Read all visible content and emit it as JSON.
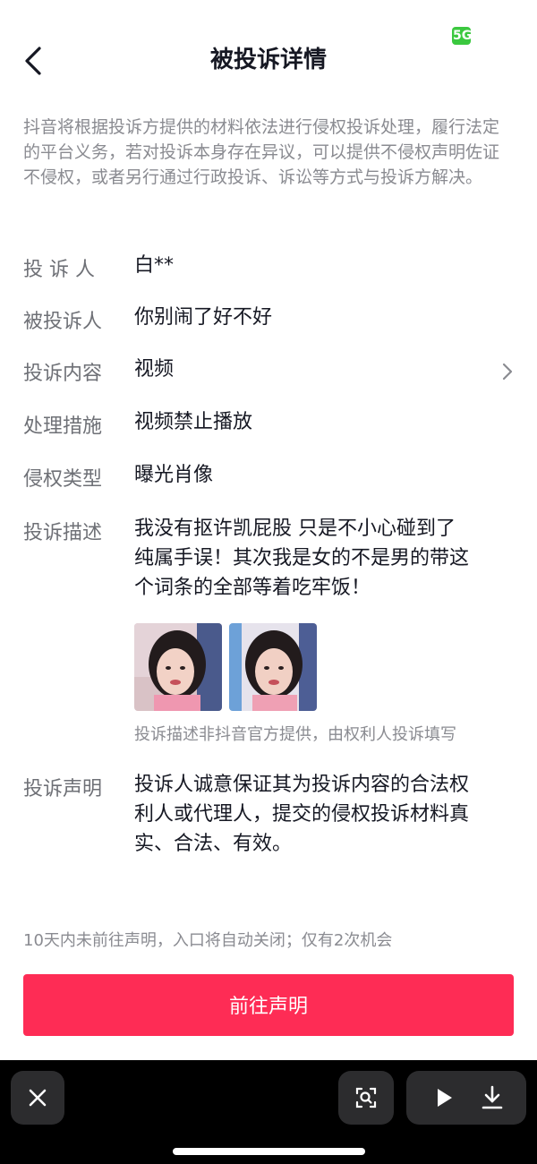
{
  "header": {
    "title": "被投诉详情",
    "signal_badge": "5G"
  },
  "intro": "抖音将根据投诉方提供的材料依法进行侵权投诉处理，履行法定的平台义务，若对投诉本身存在异议，可以提供不侵权声明佐证不侵权，或者另行通过行政投诉、诉讼等方式与投诉方解决。",
  "details": {
    "complainant": {
      "label": "投 诉 人",
      "value": "白**"
    },
    "respondent": {
      "label": "被投诉人",
      "value": "你别闹了好不好"
    },
    "content": {
      "label": "投诉内容",
      "value": "视频"
    },
    "measure": {
      "label": "处理措施",
      "value": "视频禁止播放"
    },
    "type": {
      "label": "侵权类型",
      "value": "曝光肖像"
    },
    "description": {
      "label": "投诉描述",
      "lines": [
        "我没有抠许凯屁股 只是不小心碰到了",
        "纯属手误！其次我是女的不是男的带这",
        "个词条的全部等着吃牢饭！"
      ],
      "note": "投诉描述非抖音官方提供，由权利人投诉填写"
    },
    "statement": {
      "label": "投诉声明",
      "lines": [
        "投诉人诚意保证其为投诉内容的合法权",
        "利人或代理人，提交的侵权投诉材料真",
        "实、合法、有效。"
      ]
    }
  },
  "footer": {
    "deadline": "10天内未前往声明，入口将自动关闭；仅有2次机会",
    "cta": "前往声明"
  },
  "bottom_bar": {
    "icons": [
      "close-icon",
      "scan-icon",
      "play-icon",
      "download-icon"
    ]
  },
  "colors": {
    "accent": "#fe2c55",
    "bar": "#000000",
    "button_bg": "#2c2c2e"
  }
}
